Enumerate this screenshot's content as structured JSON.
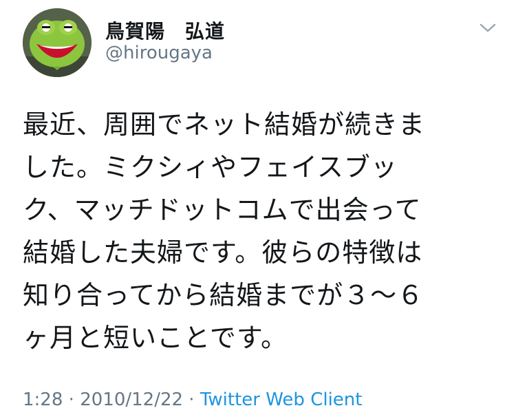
{
  "user": {
    "display_name": "鳥賀陽　弘道",
    "handle": "@hirougaya",
    "avatar_icon": "kermit-frog-avatar"
  },
  "tweet": {
    "lines": [
      "最近、周囲でネット結婚が続きま",
      "した。ミクシィやフェイスブッ",
      "ク、マッチドットコムで出会って",
      "結婚した夫婦です。彼らの特徴は",
      "知り合ってから結婚までが３～６",
      "ヶ月と短いことです。"
    ],
    "time": "1:28",
    "separator1": " · ",
    "date": "2010/12/22",
    "separator2": " · ",
    "source": "Twitter Web Client"
  },
  "colors": {
    "text": "#14171a",
    "secondary": "#657786",
    "link": "#1b95e0"
  },
  "icons": {
    "menu": "chevron-down-icon"
  }
}
